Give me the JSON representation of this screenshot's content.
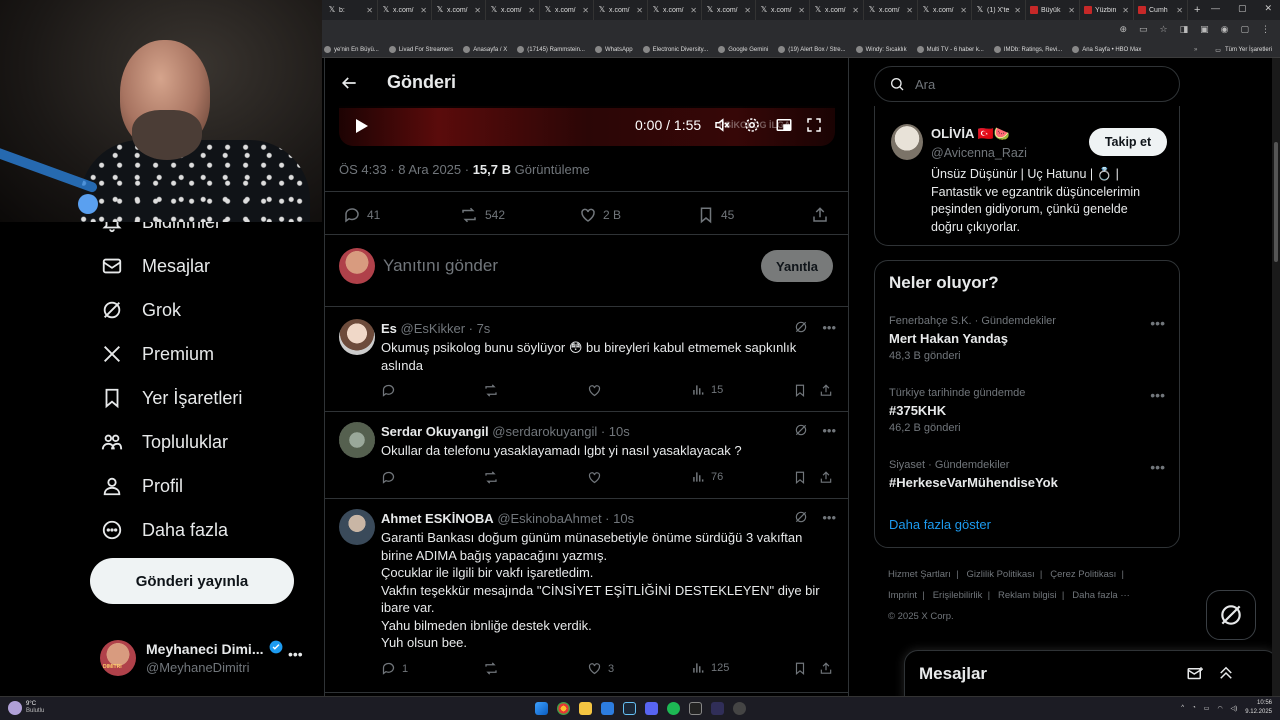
{
  "browser": {
    "tabs": [
      {
        "label": "b:",
        "kind": "x"
      },
      {
        "label": "x.com/",
        "kind": "x"
      },
      {
        "label": "x.com/",
        "kind": "x"
      },
      {
        "label": "x.com/",
        "kind": "x"
      },
      {
        "label": "x.com/",
        "kind": "x"
      },
      {
        "label": "x.com/",
        "kind": "x"
      },
      {
        "label": "x.com/",
        "kind": "x"
      },
      {
        "label": "x.com/",
        "kind": "x"
      },
      {
        "label": "x.com/",
        "kind": "x"
      },
      {
        "label": "x.com/",
        "kind": "x"
      },
      {
        "label": "x.com/",
        "kind": "x"
      },
      {
        "label": "x.com/",
        "kind": "x"
      },
      {
        "label": "(1) X'te",
        "kind": "x"
      },
      {
        "label": "Büyük",
        "kind": "red"
      },
      {
        "label": "Yüzbin",
        "kind": "red"
      },
      {
        "label": "Cumh",
        "kind": "red"
      }
    ],
    "bookmarks": [
      "ye'nin En Büyü...",
      "Livad For Streamers",
      "Anasayfa / X",
      "(17145) Rammstein...",
      "WhatsApp",
      "Electronic Diversity...",
      "Google Gemini",
      "(19) Alert Box / Stre...",
      "Windy: Sıcaklık",
      "Multi TV - 6 haber k...",
      "IMDb: Ratings, Revi...",
      "Ana Sayfa • HBO Max"
    ],
    "bookmarks_all": "Tüm Yer İşaretleri"
  },
  "leftnav": {
    "items": [
      {
        "label": "Bildirimler",
        "icon": "bell-icon"
      },
      {
        "label": "Mesajlar",
        "icon": "mail-icon"
      },
      {
        "label": "Grok",
        "icon": "grok-icon"
      },
      {
        "label": "Premium",
        "icon": "x-logo-icon"
      },
      {
        "label": "Yer İşaretleri",
        "icon": "bookmark-icon"
      },
      {
        "label": "Topluluklar",
        "icon": "communities-icon"
      },
      {
        "label": "Profil",
        "icon": "person-icon"
      },
      {
        "label": "Daha fazla",
        "icon": "more-circle-icon"
      }
    ],
    "post_button": "Gönderi yayınla",
    "profile": {
      "name": "Meyhaneci Dimi...",
      "handle": "@MeyhaneDimitri",
      "avatar_text": "DIMITRI"
    }
  },
  "main": {
    "title": "Gönderi",
    "video": {
      "time": "0:00 / 1:55",
      "overlay_text": "PSİKOLOG İLGA"
    },
    "post_meta": {
      "time": "ÖS 4:33 · 8 Ara 2025 · ",
      "views": "15,7 B",
      "views_label": " Görüntüleme"
    },
    "post_actions": {
      "replies": "41",
      "reposts": "542",
      "likes": "2 B",
      "bookmarks": "45"
    },
    "composer": {
      "placeholder": "Yanıtını gönder",
      "button": "Yanıtla"
    },
    "replies": [
      {
        "name": "Es",
        "handle": "@EsKikker · 7s",
        "text": "Okumuş psikolog bunu söylüyor 😳 bu bireyleri kabul etmemek sapkınlık aslında",
        "replies": "",
        "views": "15"
      },
      {
        "name": "Serdar Okuyangil",
        "handle": "@serdarokuyangil · 10s",
        "text": "Okullar da telefonu yasaklayamadı lgbt yi nasıl yasaklayacak ?",
        "replies": "",
        "views": "76"
      },
      {
        "name": "Ahmet ESKİNOBA",
        "handle": "@EskinobaAhmet · 10s",
        "lines": [
          "Garanti Bankası doğum günüm münasebetiyle önüme sürdüğü 3 vakıftan",
          "birine ADIMA bağış yapacağını yazmış.",
          "Çocuklar ile ilgili bir vakfı işaretledim.",
          "Vakfın teşekkür mesajında \"CİNSİYET EŞİTLİĞİNİ DESTEKLEYEN\" diye bir",
          "ibare var.",
          "Yahu bilmeden ibnliğe destek verdik.",
          "Yuh olsun bee."
        ],
        "replies": "1",
        "likes": "3",
        "views": "125"
      }
    ]
  },
  "right": {
    "search_placeholder": "Ara",
    "suggestion": {
      "name": "OLİVİA 🇹🇷🍉",
      "handle": "@Avicenna_Razi",
      "follow": "Takip et",
      "bio": [
        "Ünsüz Düşünür | Uç Hatunu | 💍 |",
        "Fantastik ve egzantrik düşüncelerimin",
        "peşinden gidiyorum, çünkü genelde",
        "doğru çıkıyorlar."
      ]
    },
    "trends_title": "Neler oluyor?",
    "trends": [
      {
        "category": "Fenerbahçe S.K. · Gündemdekiler",
        "title": "Mert Hakan Yandaş",
        "count": "48,3 B gönderi"
      },
      {
        "category": "Türkiye tarihinde gündemde",
        "title": "#375KHK",
        "count": "46,2 B gönderi"
      },
      {
        "category": "Siyaset · Gündemdekiler",
        "title": "#HerkeseVarMühendiseYok",
        "count": ""
      }
    ],
    "show_more": "Daha fazla göster",
    "footer": [
      "Hizmet Şartları",
      "Gizlilik Politikası",
      "Çerez Politikası",
      "Imprint",
      "Erişilebilirlik",
      "Reklam bilgisi",
      "Daha fazla ···",
      "© 2025 X Corp."
    ],
    "messages_drawer": "Mesajlar"
  },
  "taskbar": {
    "weather_temp": "9°C",
    "weather_desc": "Bulutlu",
    "time": "10:56",
    "date": "9.12.2025"
  },
  "colors": {
    "accent": "#1d9bf0",
    "verified": "#1d9bf0",
    "muted": "#71767b",
    "border": "#2f3336"
  }
}
